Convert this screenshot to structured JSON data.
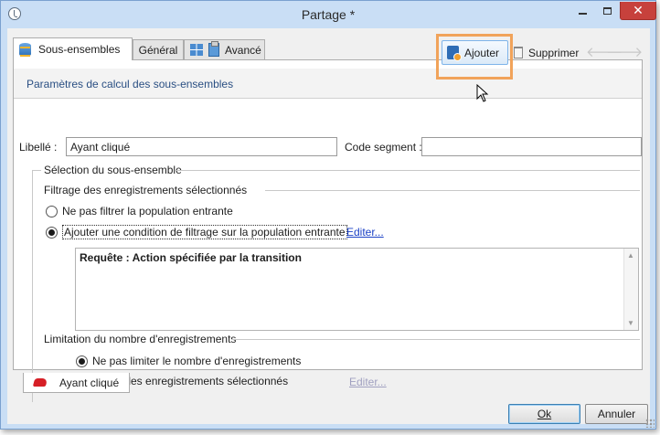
{
  "window": {
    "title": "Partage *",
    "close_glyph": "✕"
  },
  "tabs": [
    {
      "label": "Sous-ensembles",
      "icon": "database-icon",
      "active": true
    },
    {
      "label": "Général",
      "icon": "grid-icon",
      "active": false
    },
    {
      "label": "Avancé",
      "icon": "clipboard-icon",
      "active": false
    }
  ],
  "subheader": {
    "title": "Paramètres de calcul des sous-ensembles"
  },
  "toolbar": {
    "add_label": "Ajouter",
    "delete_label": "Supprimer",
    "prev_glyph": "🡐",
    "next_glyph": "🡒"
  },
  "form": {
    "libelle_label": "Libellé :",
    "libelle_value": "Ayant cliqué",
    "code_segment_label": "Code segment :",
    "code_segment_value": ""
  },
  "subset_section": {
    "title": "Sélection du sous-ensemble",
    "filtering_title": "Filtrage des enregistrements sélectionnés",
    "option_no_filter": "Ne pas filtrer la population entrante",
    "option_add_condition": "Ajouter une condition de filtrage sur la population entrante",
    "selected_option": "option_add_condition",
    "edit_link": "Editer...",
    "query_text": "Requête : Action spécifiée par la transition"
  },
  "limit_section": {
    "title": "Limitation du nombre d'enregistrements",
    "option_no_limit": "Ne pas limiter le nombre d'enregistrements",
    "option_limit": "Limiter les enregistrements sélectionnés",
    "selected_option": "option_no_limit",
    "edit_link": "Editer..."
  },
  "bottom_tabs": [
    {
      "label": "Ayant cliqué",
      "icon": "stamp-icon"
    }
  ],
  "buttons": {
    "ok": "Ok",
    "cancel": "Annuler"
  },
  "colors": {
    "highlight": "#f1a35a",
    "link": "#1a40c6",
    "subheader_title": "#2a4f83",
    "close_button": "#c7413c"
  }
}
